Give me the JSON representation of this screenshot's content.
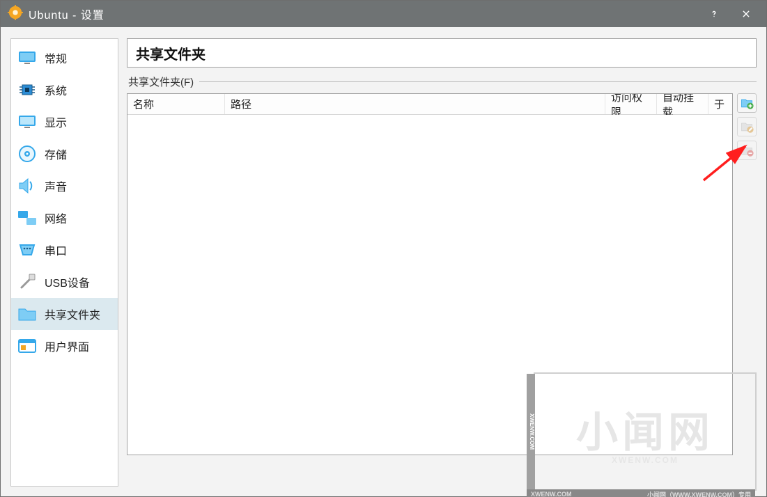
{
  "window": {
    "title": "Ubuntu - 设置"
  },
  "sidebar": {
    "items": [
      {
        "label": "常规",
        "icon": "general",
        "selected": false
      },
      {
        "label": "系统",
        "icon": "system",
        "selected": false
      },
      {
        "label": "显示",
        "icon": "display",
        "selected": false
      },
      {
        "label": "存储",
        "icon": "storage",
        "selected": false
      },
      {
        "label": "声音",
        "icon": "audio",
        "selected": false
      },
      {
        "label": "网络",
        "icon": "network",
        "selected": false
      },
      {
        "label": "串口",
        "icon": "serial",
        "selected": false
      },
      {
        "label": "USB设备",
        "icon": "usb",
        "selected": false
      },
      {
        "label": "共享文件夹",
        "icon": "folder",
        "selected": true
      },
      {
        "label": "用户界面",
        "icon": "ui",
        "selected": false
      }
    ]
  },
  "main": {
    "page_title": "共享文件夹",
    "group_label": "共享文件夹(F)",
    "columns": {
      "name": "名称",
      "path": "路径",
      "access": "访问权限",
      "mount": "自动挂载",
      "at": "于"
    },
    "rows": []
  },
  "watermark": {
    "big": "小闻网",
    "sub": "XWENW.COM",
    "strip": "XWENW.COM",
    "bottom_left": "XWENW.COM",
    "bottom_right": "小闻网（WWW.XWENW.COM）专用"
  }
}
